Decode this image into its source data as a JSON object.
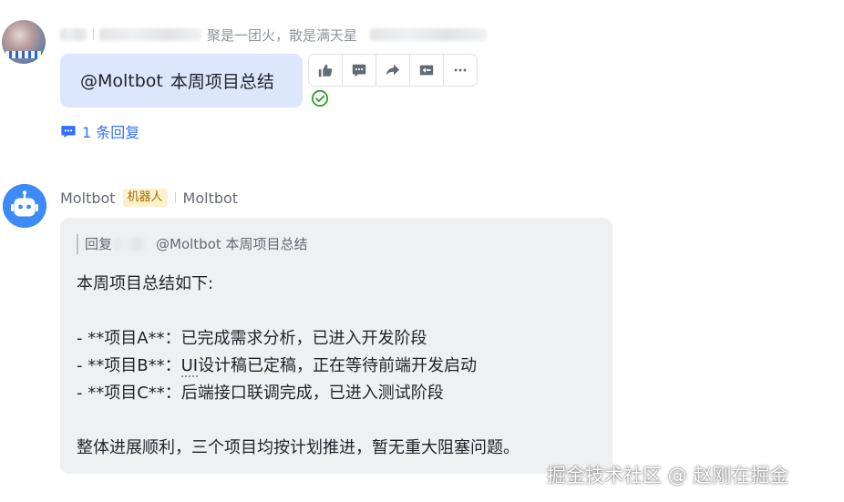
{
  "user_message": {
    "name_suffix": "聚是一团火，散是满天星",
    "text_mention": "@Moltbot",
    "text_body": "本周项目总结",
    "actions": [
      "thumbs-up-icon",
      "comment-icon",
      "forward-icon",
      "quote-icon",
      "more-icon"
    ],
    "status_icon": "check-circle-icon",
    "reply_count_label": "1 条回复"
  },
  "bot_message": {
    "name": "Moltbot",
    "badge": "机器人",
    "source": "Moltbot",
    "quote_prefix": "回复",
    "quote_text": "@Moltbot 本周项目总结",
    "intro": "本周项目总结如下:",
    "items": [
      {
        "prefix": "- **项目A**：",
        "text": "已完成需求分析，已进入开发阶段"
      },
      {
        "prefix": "- **项目B**：",
        "ui": "UI",
        "text": "设计稿已定稿，正在等待前端开发启动"
      },
      {
        "prefix": "- **项目C**：",
        "text": "后端接口联调完成，已进入测试阶段"
      }
    ],
    "conclusion": "整体进展顺利，三个项目均按计划推进，暂无重大阻塞问题。"
  },
  "watermark": "掘金技术社区 @ 赵刚在掘金",
  "colors": {
    "accent": "#3370ff",
    "user_bubble": "#dce7fd",
    "bot_bubble": "#eff0f1",
    "success": "#2ea121",
    "bot_avatar": "#3c8bf6"
  }
}
